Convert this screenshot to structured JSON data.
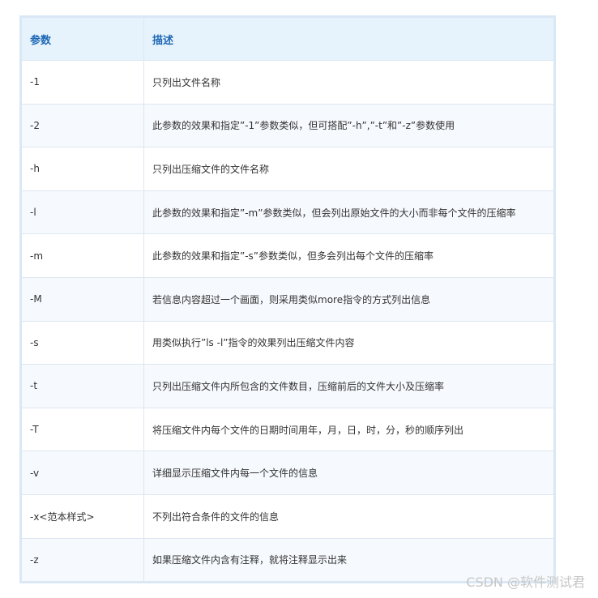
{
  "table": {
    "headers": [
      "参数",
      "描述"
    ],
    "rows": [
      {
        "param": "-1",
        "desc": "只列出文件名称"
      },
      {
        "param": "-2",
        "desc": "此参数的效果和指定”-1”参数类似，但可搭配”-h”,”-t”和”-z”参数使用"
      },
      {
        "param": "-h",
        "desc": "只列出压缩文件的文件名称"
      },
      {
        "param": "-l",
        "desc": "此参数的效果和指定”-m”参数类似，但会列出原始文件的大小而非每个文件的压缩率"
      },
      {
        "param": "-m",
        "desc": "此参数的效果和指定”-s”参数类似，但多会列出每个文件的压缩率"
      },
      {
        "param": "-M",
        "desc": "若信息内容超过一个画面，则采用类似more指令的方式列出信息"
      },
      {
        "param": "-s",
        "desc": "用类似执行”ls -l”指令的效果列出压缩文件内容"
      },
      {
        "param": "-t",
        "desc": "只列出压缩文件内所包含的文件数目，压缩前后的文件大小及压缩率"
      },
      {
        "param": "-T",
        "desc": "将压缩文件内每个文件的日期时间用年，月，日，时，分，秒的顺序列出"
      },
      {
        "param": "-v",
        "desc": "详细显示压缩文件内每一个文件的信息"
      },
      {
        "param": "-x<范本样式>",
        "desc": "不列出符合条件的文件的信息"
      },
      {
        "param": "-z",
        "desc": "如果压缩文件内含有注释，就将注释显示出来"
      }
    ]
  },
  "watermark": "CSDN @软件测试君"
}
